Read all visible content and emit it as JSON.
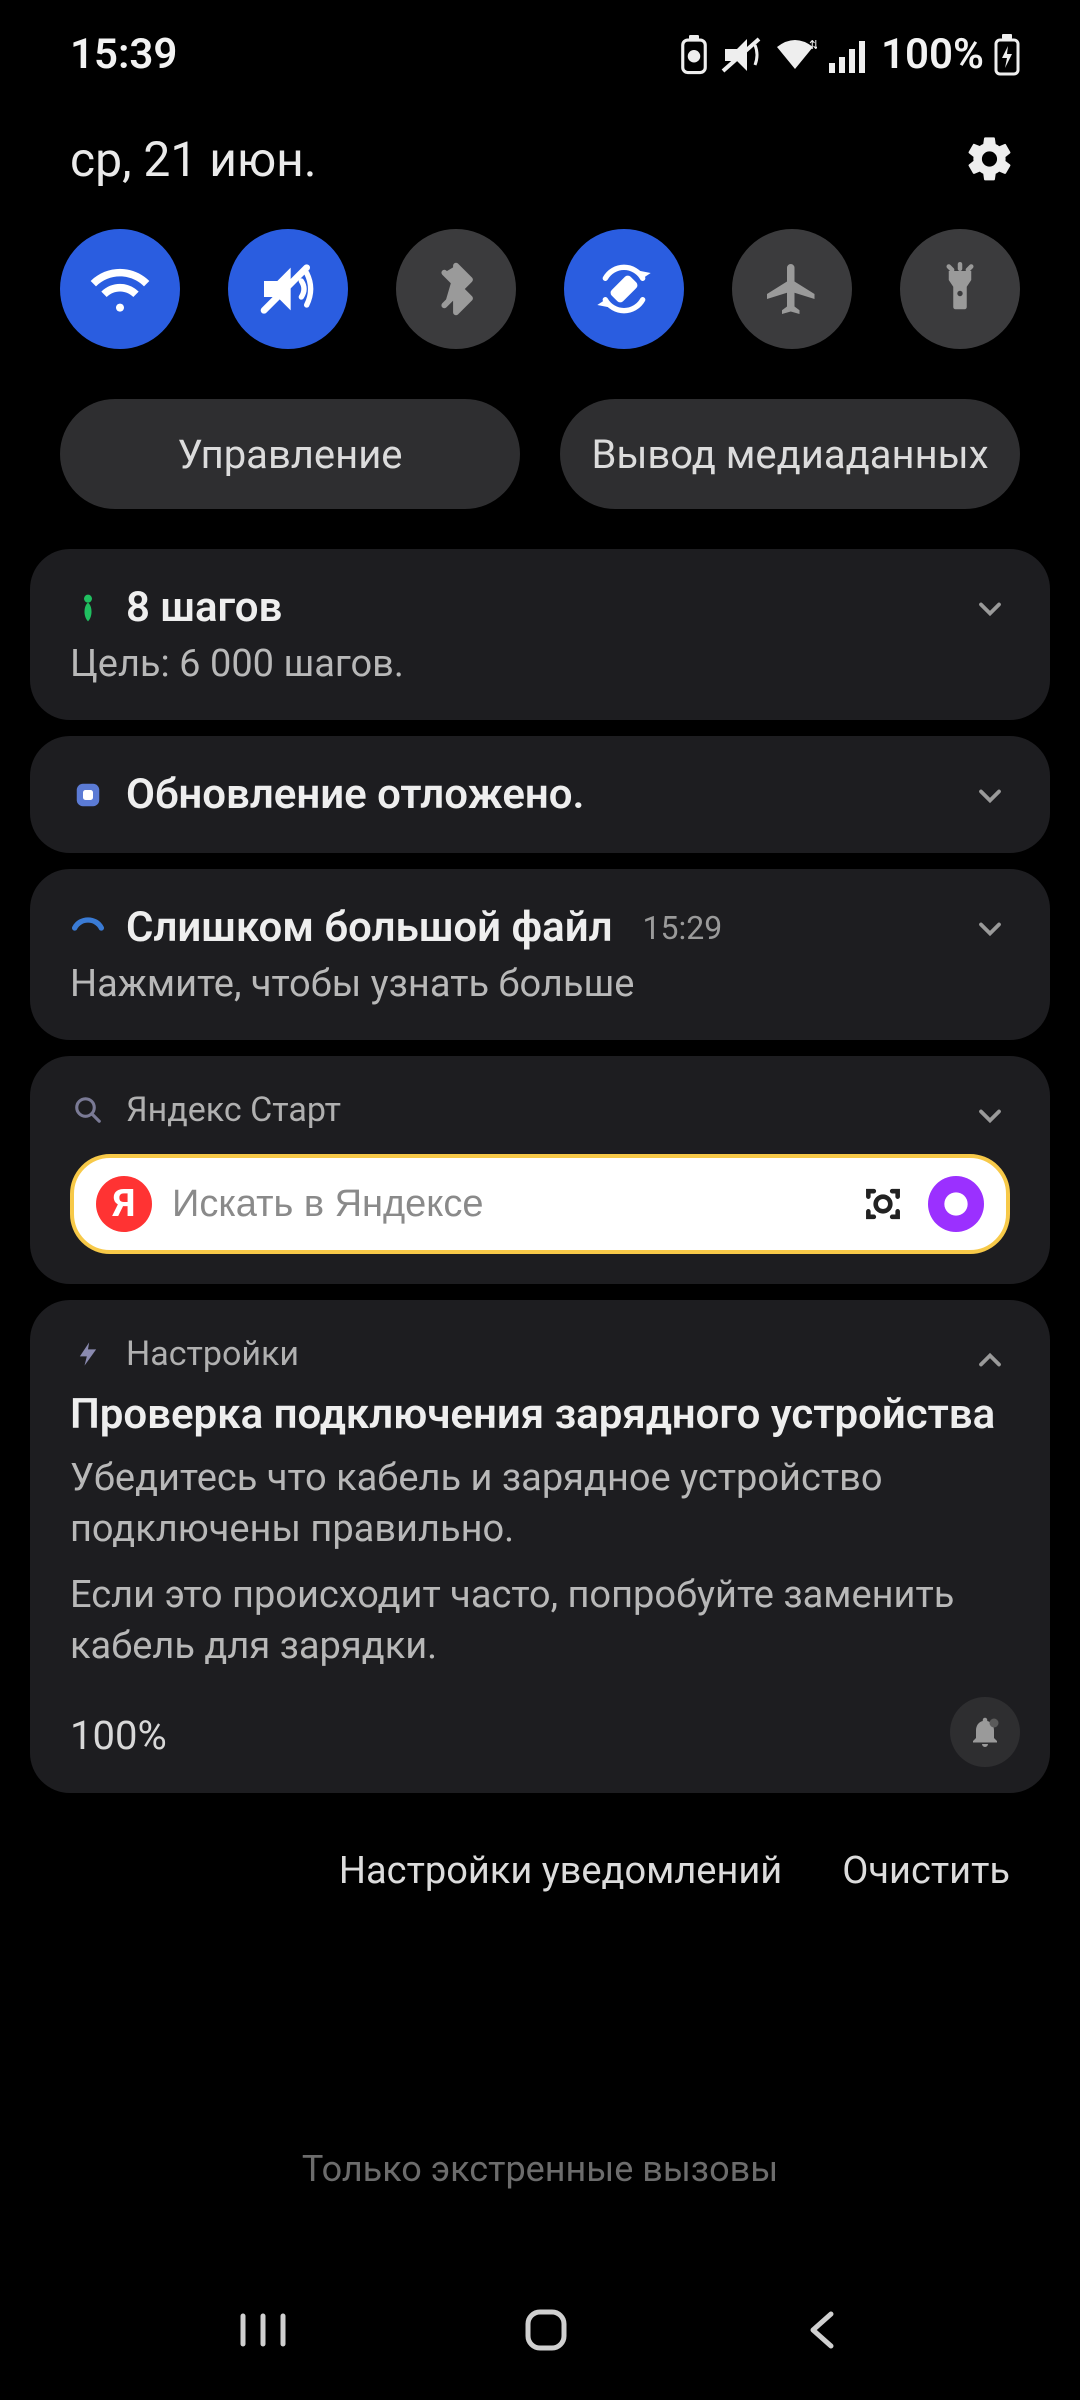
{
  "status": {
    "time": "15:39",
    "battery_text": "100%"
  },
  "header": {
    "date": "ср, 21 июн."
  },
  "quick_toggles": [
    {
      "name": "wifi",
      "on": true
    },
    {
      "name": "mute",
      "on": true
    },
    {
      "name": "bluetooth",
      "on": false
    },
    {
      "name": "rotate",
      "on": true
    },
    {
      "name": "airplane",
      "on": false
    },
    {
      "name": "flashlight",
      "on": false
    }
  ],
  "pills": {
    "devices_label": "Управление",
    "media_label": "Вывод медиаданных"
  },
  "notifications": [
    {
      "app_icon": "health",
      "title": "8 шагов",
      "subtitle": "Цель: 6 000 шагов.",
      "expanded": false
    },
    {
      "app_icon": "galaxy-store",
      "title": "Обновление отложено.",
      "expanded": false
    },
    {
      "app_icon": "send-anywhere",
      "title": "Слишком большой файл",
      "time": "15:29",
      "subtitle": "Нажмите, чтобы узнать больше",
      "expanded": false
    },
    {
      "app_icon": "search",
      "app_name": "Яндекс Старт",
      "search_placeholder": "Искать в Яндексе",
      "expanded": false
    },
    {
      "app_icon": "bolt",
      "app_name": "Настройки",
      "body_title": "Проверка подключения зарядного устройства",
      "body_text_1": "Убедитесь что кабель и зарядное устройство подключены правильно.",
      "body_text_2": "Если это происходит часто, попробуйте заменить кабель для зарядки.",
      "percent": "100%",
      "expanded": true
    }
  ],
  "footer": {
    "settings_label": "Настройки уведомлений",
    "clear_label": "Очистить"
  },
  "emergency_text": "Только экстренные вызовы"
}
